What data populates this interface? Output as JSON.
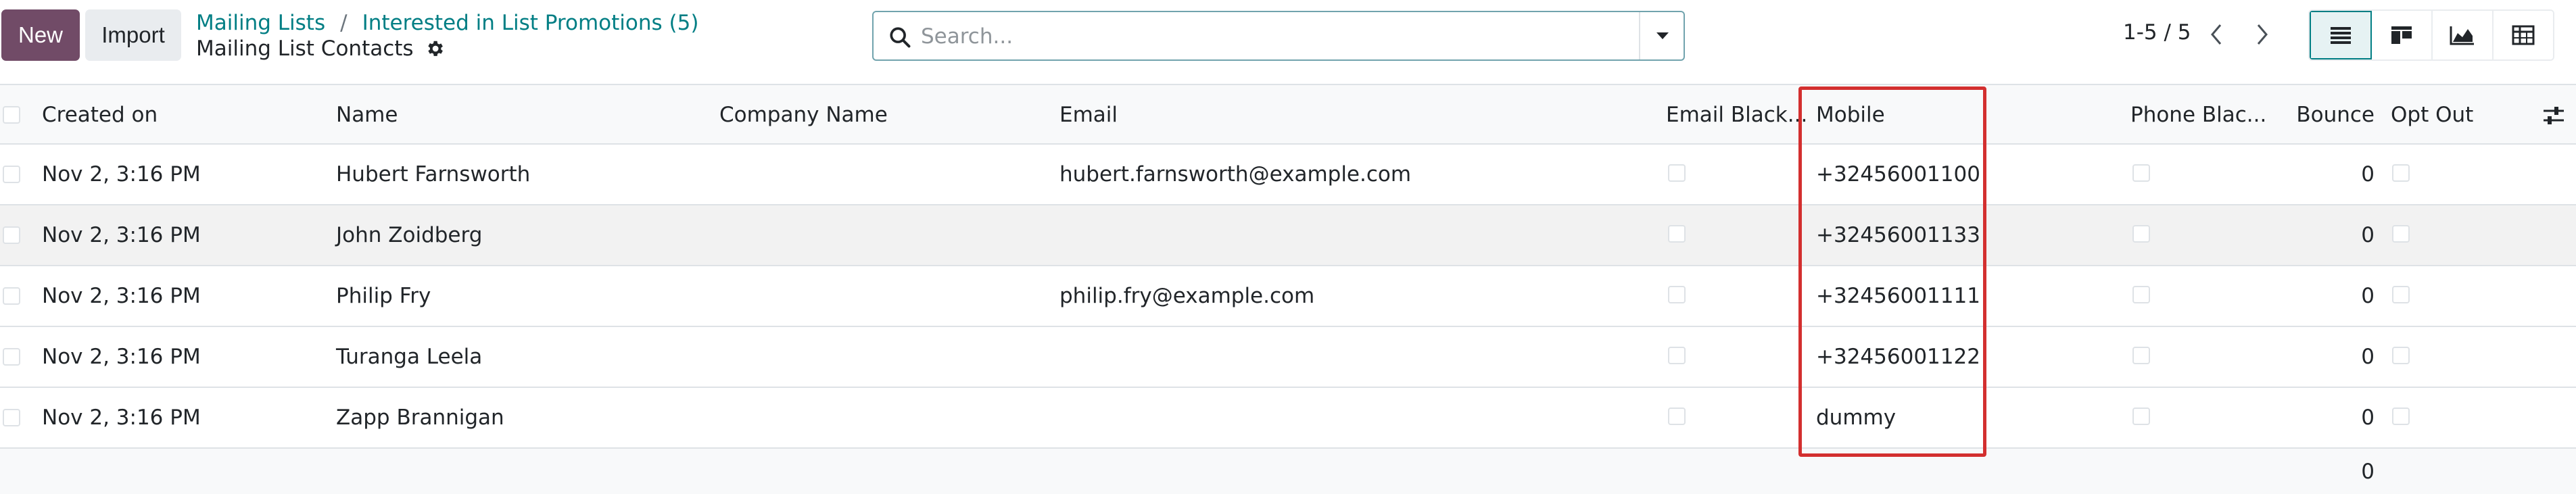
{
  "toolbar": {
    "new_label": "New",
    "import_label": "Import"
  },
  "breadcrumb": {
    "items": [
      "Mailing Lists",
      "Interested in List Promotions (5)"
    ],
    "separator": "/"
  },
  "page": {
    "title": "Mailing List Contacts",
    "settings_icon": "gear-icon"
  },
  "search": {
    "placeholder": "Search...",
    "value": "",
    "icon": "search-icon",
    "toggle_icon": "caret-down-icon"
  },
  "pager": {
    "value": "1-5 / 5",
    "prev_icon": "chevron-left-icon",
    "next_icon": "chevron-right-icon"
  },
  "views": [
    {
      "name": "list",
      "icon": "list-icon",
      "active": true
    },
    {
      "name": "kanban",
      "icon": "kanban-icon",
      "active": false
    },
    {
      "name": "graph",
      "icon": "area-chart-icon",
      "active": false
    },
    {
      "name": "pivot",
      "icon": "pivot-table-icon",
      "active": false
    }
  ],
  "table": {
    "columns": {
      "created_on": "Created on",
      "name": "Name",
      "company_name": "Company Name",
      "email": "Email",
      "email_blacklist": "Email Black...",
      "mobile": "Mobile",
      "phone_blacklist": "Phone Blac...",
      "bounce": "Bounce",
      "opt_out": "Opt Out"
    },
    "optional_columns_icon": "sliders-icon",
    "rows": [
      {
        "created_on": "Nov 2, 3:16 PM",
        "name": "Hubert Farnsworth",
        "company_name": "",
        "email": "hubert.farnsworth@example.com",
        "mobile": "+32456001100",
        "bounce": "0"
      },
      {
        "created_on": "Nov 2, 3:16 PM",
        "name": "John Zoidberg",
        "company_name": "",
        "email": "",
        "mobile": "+32456001133",
        "bounce": "0"
      },
      {
        "created_on": "Nov 2, 3:16 PM",
        "name": "Philip Fry",
        "company_name": "",
        "email": "philip.fry@example.com",
        "mobile": "+32456001111",
        "bounce": "0"
      },
      {
        "created_on": "Nov 2, 3:16 PM",
        "name": "Turanga Leela",
        "company_name": "",
        "email": "",
        "mobile": "+32456001122",
        "bounce": "0"
      },
      {
        "created_on": "Nov 2, 3:16 PM",
        "name": "Zapp Brannigan",
        "company_name": "",
        "email": "",
        "mobile": "dummy",
        "bounce": "0"
      }
    ],
    "footer": {
      "bounce_total": "0"
    }
  },
  "colors": {
    "primary": "#714b67",
    "link": "#017e84",
    "highlight": "#d32f2f",
    "border": "#dee2e6"
  }
}
